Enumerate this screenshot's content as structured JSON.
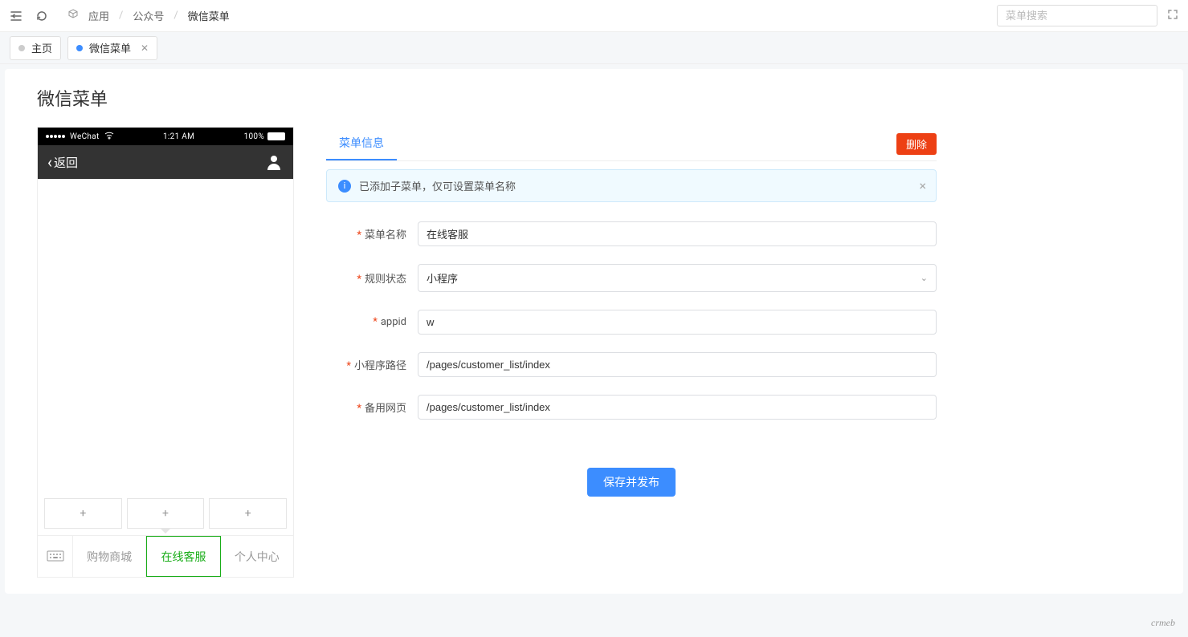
{
  "header": {
    "breadcrumb": {
      "item1": "应用",
      "item2": "公众号",
      "current": "微信菜单"
    },
    "search_placeholder": "菜单搜索"
  },
  "tabs": {
    "home": "主页",
    "current": "微信菜单"
  },
  "page": {
    "title": "微信菜单"
  },
  "phone": {
    "carrier": "WeChat",
    "time": "1:21 AM",
    "battery": "100%",
    "back_label": "返回",
    "bottom_menu": {
      "m1": "购物商城",
      "m2": "在线客服",
      "m3": "个人中心"
    },
    "add_label": "+"
  },
  "form": {
    "tab_label": "菜单信息",
    "delete_btn": "删除",
    "info_text": "已添加子菜单，仅可设置菜单名称",
    "fields": {
      "name_label": "菜单名称",
      "name_value": "在线客服",
      "status_label": "规则状态",
      "status_value": "小程序",
      "appid_label": "appid",
      "appid_value": "w",
      "path_label": "小程序路径",
      "path_value": "/pages/customer_list/index",
      "fallback_label": "备用网页",
      "fallback_value": "/pages/customer_list/index"
    },
    "save_btn": "保存并发布"
  },
  "brand": "crmeb"
}
